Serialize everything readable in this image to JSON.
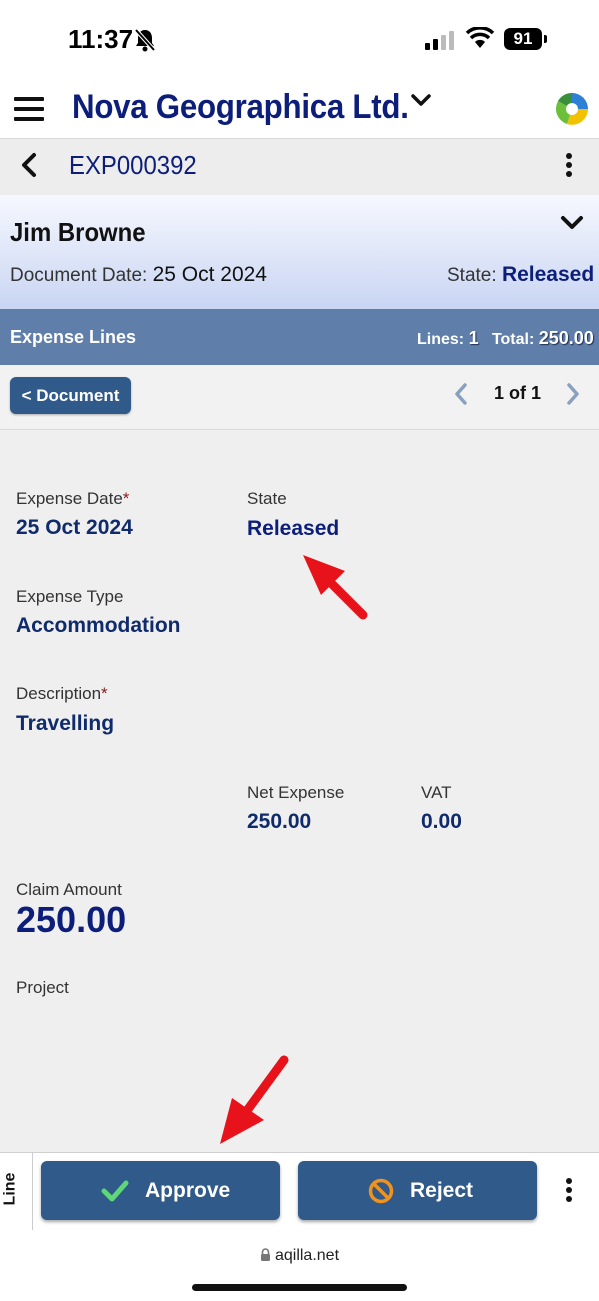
{
  "status_bar": {
    "time": "11:37",
    "battery": "91"
  },
  "header": {
    "company": "Nova Geographica Ltd."
  },
  "doc_bar": {
    "number": "EXP000392"
  },
  "person": {
    "name": "Jim Browne",
    "doc_date_label": "Document Date:",
    "doc_date": "25 Oct 2024",
    "state_label": "State:",
    "state": "Released"
  },
  "lines_bar": {
    "title": "Expense Lines",
    "lines_label": "Lines:",
    "lines": "1",
    "total_label": "Total:",
    "total": "250.00"
  },
  "nav": {
    "document_button": "< Document",
    "page": "1 of 1"
  },
  "detail": {
    "expense_date_label": "Expense Date",
    "required_mark": "*",
    "expense_date": "25 Oct 2024",
    "state_label": "State",
    "state": "Released",
    "expense_type_label": "Expense Type",
    "expense_type": "Accommodation",
    "description_label": "Description",
    "description": "Travelling",
    "net_label": "Net Expense",
    "net": "250.00",
    "vat_label": "VAT",
    "vat": "0.00",
    "claim_label": "Claim Amount",
    "claim": "250.00",
    "project_label": "Project"
  },
  "bottom": {
    "line_tab": "Line",
    "approve": "Approve",
    "reject": "Reject"
  },
  "browser": {
    "url": "aqilla.net"
  },
  "colors": {
    "navy": "#0c1e7a",
    "button": "#2f5a8a",
    "lines_bar": "#5f7ea9",
    "annotation_arrow": "#e8121a"
  }
}
